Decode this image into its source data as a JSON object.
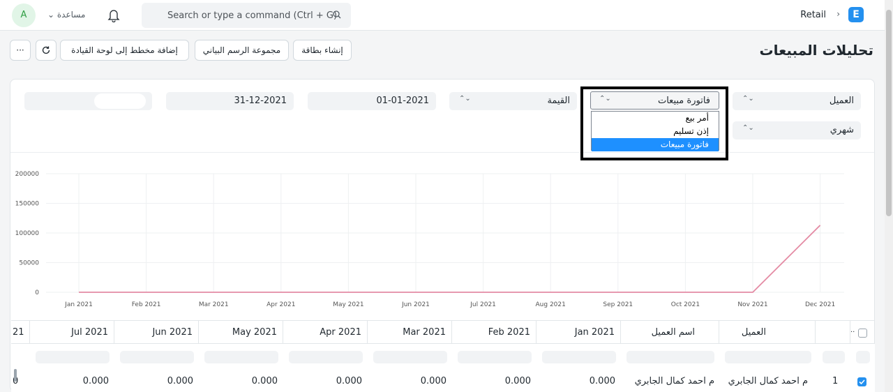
{
  "navbar": {
    "brand_letter": "E",
    "breadcrumb": "Retail",
    "breadcrumb_sep": "›",
    "search_placeholder": "Search or type a command (Ctrl + G)",
    "help_label": "مساعدة",
    "avatar_letter": "A"
  },
  "page": {
    "title": "تحليلات المبيعات",
    "buttons": {
      "new_card": "إنشاء بطاقة",
      "chart_group": "مجموعة الرسم البياني",
      "add_chart": "إضافة مخطط إلى لوحة القيادة",
      "more": "···"
    }
  },
  "filters": {
    "tree_type": "العميل",
    "doc_type": "فاتورة مبيعات",
    "value_quantity": "القيمة",
    "from_date": "01-01-2021",
    "to_date": "31-12-2021",
    "range": "شهري"
  },
  "dropdown": {
    "options": [
      "أمر بيع",
      "إذن تسليم",
      "فاتورة مبيعات"
    ],
    "selected_index": 2
  },
  "chart_data": {
    "type": "line",
    "x": [
      "Jan 2021",
      "Feb 2021",
      "Mar 2021",
      "Apr 2021",
      "May 2021",
      "Jun 2021",
      "Jul 2021",
      "Aug 2021",
      "Sep 2021",
      "Oct 2021",
      "Nov 2021",
      "Dec 2021"
    ],
    "series": [
      {
        "values": [
          0,
          0,
          0,
          0,
          0,
          0,
          0,
          0,
          0,
          0,
          0,
          113000
        ]
      }
    ],
    "yticks": [
      "0",
      "50000",
      "100000",
      "150000",
      "200000"
    ],
    "ylim": [
      0,
      200000
    ],
    "grid": true,
    "line_color": "#e48ba4"
  },
  "table": {
    "headers": [
      "العميل",
      "اسم العميل",
      "Jan 2021",
      "Feb 2021",
      "Mar 2021",
      "Apr 2021",
      "May 2021",
      "Jun 2021",
      "Jul 2021",
      "21"
    ],
    "row": {
      "index": "1",
      "customer": "م احمد كمال الجابري",
      "customer_name": "م احمد كمال الجابري",
      "values": [
        "0.000",
        "0.000",
        "0.000",
        "0.000",
        "0.000",
        "0.000",
        "0.000",
        "0"
      ]
    }
  }
}
